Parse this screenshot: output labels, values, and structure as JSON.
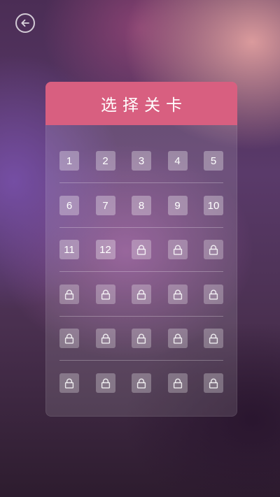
{
  "header": {
    "back_icon": "arrow-left-circle-icon"
  },
  "panel": {
    "title": "选择关卡"
  },
  "levels": [
    {
      "number": "1",
      "locked": false
    },
    {
      "number": "2",
      "locked": false
    },
    {
      "number": "3",
      "locked": false
    },
    {
      "number": "4",
      "locked": false
    },
    {
      "number": "5",
      "locked": false
    },
    {
      "number": "6",
      "locked": false
    },
    {
      "number": "7",
      "locked": false
    },
    {
      "number": "8",
      "locked": false
    },
    {
      "number": "9",
      "locked": false
    },
    {
      "number": "10",
      "locked": false
    },
    {
      "number": "11",
      "locked": false
    },
    {
      "number": "12",
      "locked": false
    },
    {
      "number": "",
      "locked": true
    },
    {
      "number": "",
      "locked": true
    },
    {
      "number": "",
      "locked": true
    },
    {
      "number": "",
      "locked": true
    },
    {
      "number": "",
      "locked": true
    },
    {
      "number": "",
      "locked": true
    },
    {
      "number": "",
      "locked": true
    },
    {
      "number": "",
      "locked": true
    },
    {
      "number": "",
      "locked": true
    },
    {
      "number": "",
      "locked": true
    },
    {
      "number": "",
      "locked": true
    },
    {
      "number": "",
      "locked": true
    },
    {
      "number": "",
      "locked": true
    },
    {
      "number": "",
      "locked": true
    },
    {
      "number": "",
      "locked": true
    },
    {
      "number": "",
      "locked": true
    },
    {
      "number": "",
      "locked": true
    },
    {
      "number": "",
      "locked": true
    }
  ],
  "colors": {
    "header_accent": "#d85f80",
    "text": "#ffffff"
  },
  "icons": {
    "locked": "lock-icon"
  }
}
